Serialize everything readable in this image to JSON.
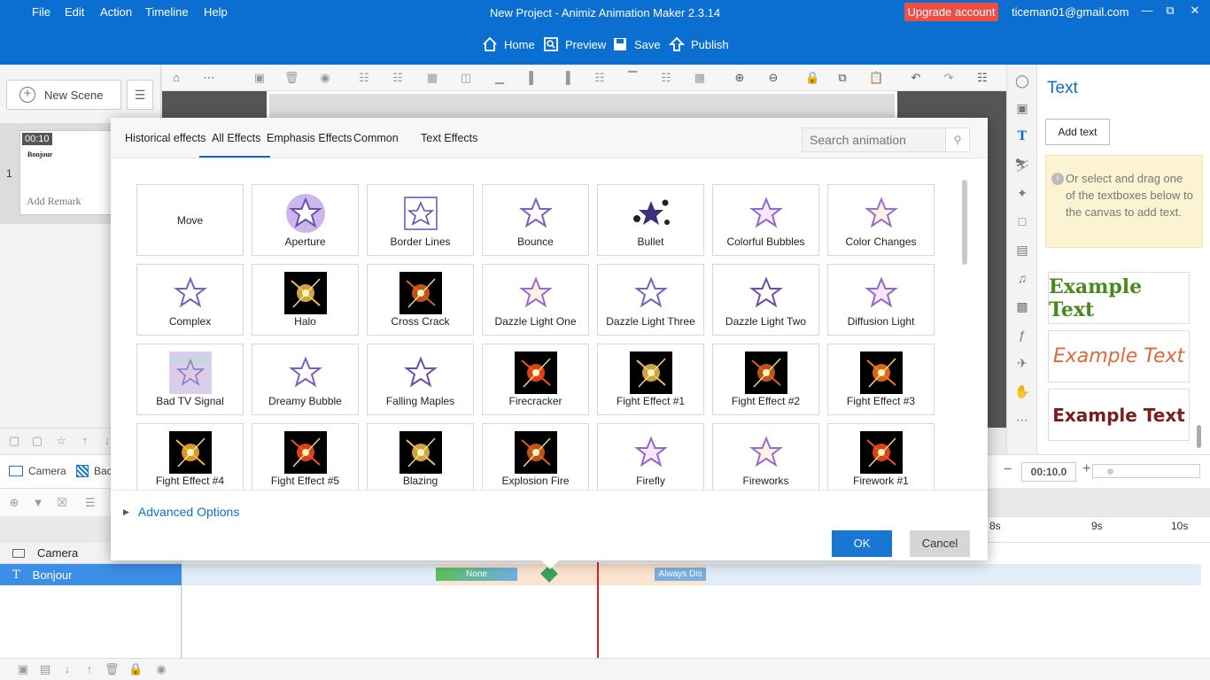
{
  "menu": [
    "File",
    "Edit",
    "Action",
    "Timeline",
    "Help"
  ],
  "app_title": "New Project - Animiz Animation Maker 2.3.14",
  "upgrade_label": "Upgrade account",
  "user_email": "ticeman01@gmail.com",
  "main_buttons": {
    "home": "Home",
    "preview": "Preview",
    "save": "Save",
    "publish": "Publish"
  },
  "scene_panel": {
    "new_scene": "New Scene",
    "scene_time": "00:10",
    "scene_text": "Bonjour",
    "add_remark": "Add Remark",
    "scene_number": "1"
  },
  "text_panel": {
    "title": "Text",
    "add_text": "Add text",
    "hint": "Or select and drag one of the textboxes below to the canvas to add text.",
    "examples": [
      "Example Text",
      "Example Text",
      "Example Text"
    ]
  },
  "dialog": {
    "tabs": [
      "Historical effects",
      "All Effects",
      "Emphasis Effects",
      "Common",
      "Text Effects"
    ],
    "active_tab": "All Effects",
    "search_placeholder": "Search animation",
    "effects": [
      "Move",
      "Aperture",
      "Border Lines",
      "Bounce",
      "Bullet",
      "Colorful Bubbles",
      "Color Changes",
      "Complex",
      "Halo",
      "Cross Crack",
      "Dazzle Light One",
      "Dazzle Light Three",
      "Dazzle Light Two",
      "Diffusion Light",
      "Bad TV Signal",
      "Dreamy Bubble",
      "Falling Maples",
      "Firecracker",
      "Fight Effect #1",
      "Fight Effect #2",
      "Fight Effect #3",
      "Fight Effect #4",
      "Fight Effect #5",
      "Blazing",
      "Explosion Fire",
      "Firefly",
      "Fireworks",
      "Firework #1"
    ],
    "advanced_options": "Advanced Options",
    "ok": "OK",
    "cancel": "Cancel"
  },
  "timeline": {
    "camera_btn": "Camera",
    "bg_btn": "Bac",
    "time_value": "00:10.0",
    "ruler": [
      "8s",
      "9s",
      "10s"
    ],
    "rows": {
      "camera": "Camera",
      "bonjour": "Bonjour"
    },
    "bar_none": "None",
    "bar_always": "Always Dis"
  },
  "colors": {
    "brand": "#0b6fd1",
    "upgrade": "#ee4f45",
    "ok": "#1777d3"
  }
}
